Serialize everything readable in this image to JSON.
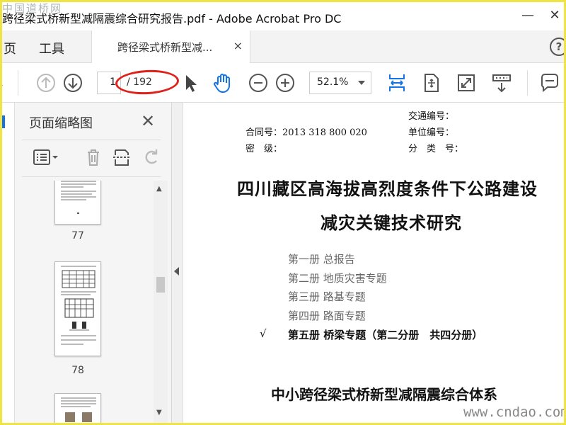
{
  "window": {
    "title": "跨径梁式桥新型减隔震综合研究报告.pdf - Adobe Acrobat Pro DC",
    "watermark_top": "中国道桥网",
    "minimize_glyph": "—",
    "close_glyph": "✕"
  },
  "tabs": {
    "home_label": "页",
    "tools_label": "工具",
    "doc_tab_label": "跨径梁式桥新型减...",
    "doc_tab_close": "×",
    "help_label": "?"
  },
  "toolbar": {
    "current_page": "1",
    "total_pages": "/ 192",
    "zoom": "52.1%",
    "icons": [
      "prev-page-icon",
      "next-page-icon",
      "select-cursor-icon",
      "hand-tool-icon",
      "zoom-out-icon",
      "zoom-in-icon",
      "fit-width-icon",
      "fit-page-icon",
      "full-screen-icon",
      "read-mode-icon",
      "comment-icon"
    ]
  },
  "sidebar": {
    "title": "页面缩略图",
    "close_glyph": "✕",
    "thumbnails": [
      {
        "page": "77"
      },
      {
        "page": "78"
      }
    ]
  },
  "document": {
    "contract_no": "合同号：2013 318 800 020",
    "security_level": "密　级：",
    "traffic_no": "交通编号：",
    "unit_no": "单位编号：",
    "classification_no": "分　类　号：",
    "title_line1": "四川藏区高海拔高烈度条件下公路建设",
    "title_line2": "减灾关键技术研究",
    "volumes": [
      {
        "label": "第一册  总报告"
      },
      {
        "label": "第二册  地质灾害专题"
      },
      {
        "label": "第三册  路基专题"
      },
      {
        "label": "第四册  路面专题"
      },
      {
        "label": "第五册  桥梁专题（第二分册　共四分册）"
      }
    ],
    "check": "√",
    "subtitle": "中小跨径梁式桥新型减隔震综合体系",
    "watermark_bottom": "www.cndao.com"
  },
  "colors": {
    "accent_blue": "#1473e6",
    "annotation_red": "#e0201a",
    "frame_yellow": "#f0e442"
  }
}
